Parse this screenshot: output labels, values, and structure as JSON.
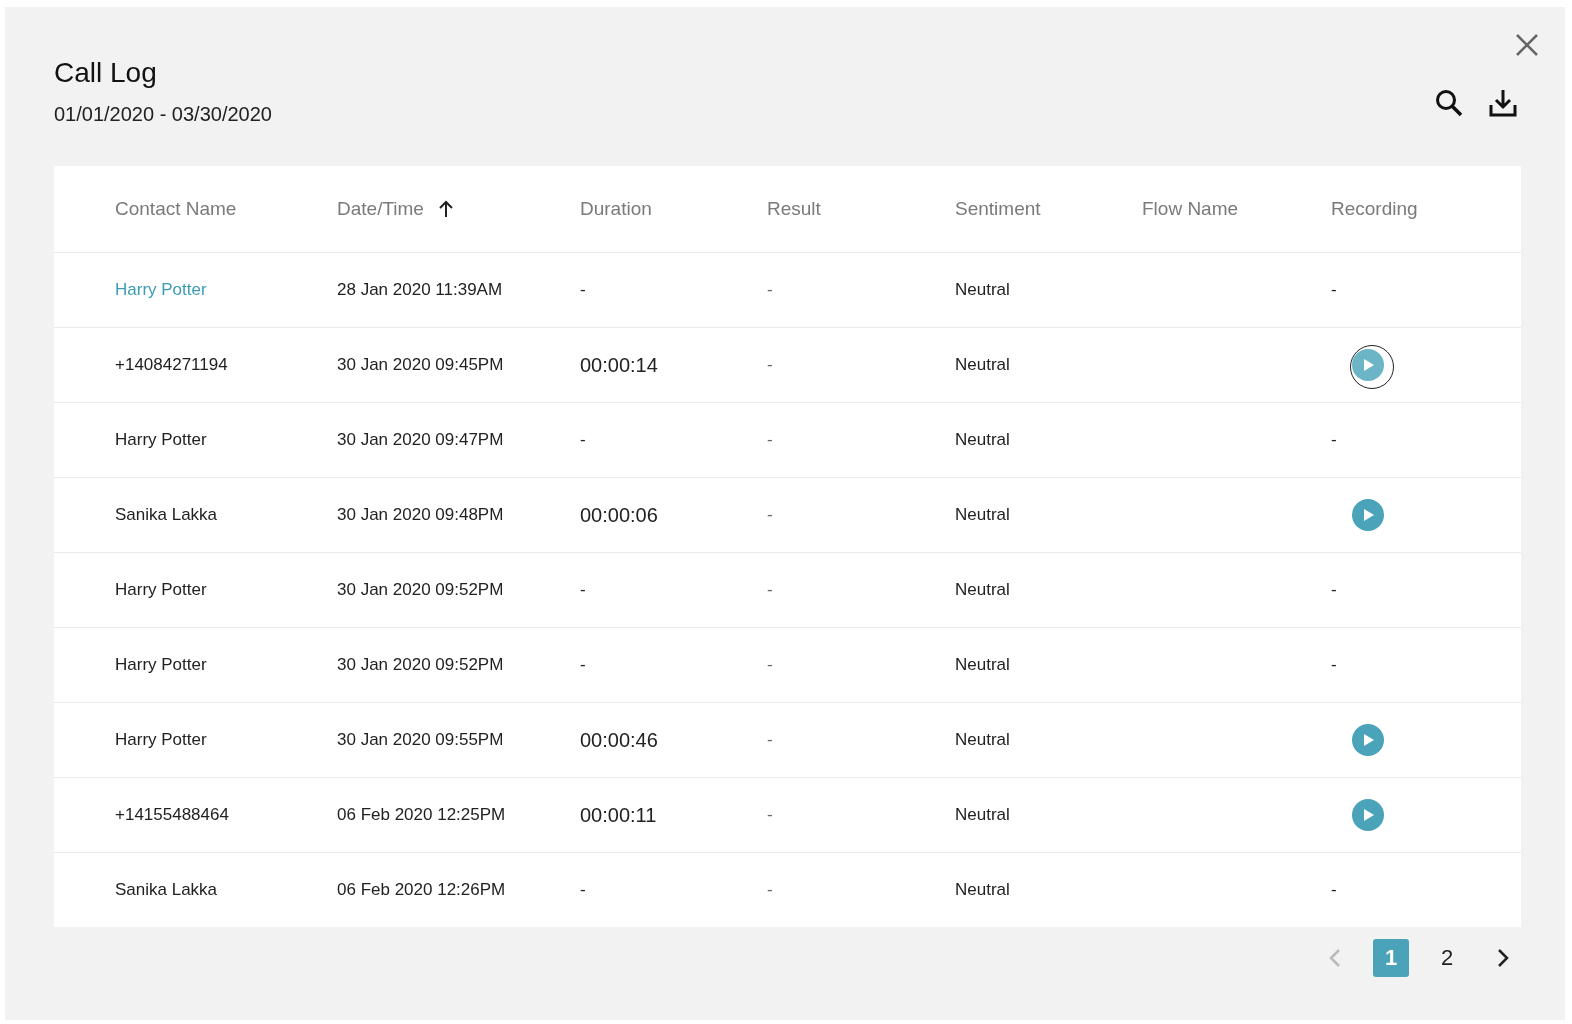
{
  "dialog": {
    "title": "Call Log",
    "date_range": "01/01/2020 - 03/30/2020"
  },
  "table": {
    "columns": [
      {
        "label": "Contact Name",
        "sorted": false
      },
      {
        "label": "Date/Time",
        "sorted": true
      },
      {
        "label": "Duration",
        "sorted": false
      },
      {
        "label": "Result",
        "sorted": false
      },
      {
        "label": "Sentiment",
        "sorted": false
      },
      {
        "label": "Flow Name",
        "sorted": false
      },
      {
        "label": "Recording",
        "sorted": false
      }
    ],
    "rows": [
      {
        "contact": "Harry Potter",
        "link": true,
        "datetime": "28 Jan 2020 11:39AM",
        "duration": "-",
        "result": "-",
        "sentiment": "Neutral",
        "recording": {
          "kind": "none",
          "text": "-"
        }
      },
      {
        "contact": "+14084271194",
        "link": false,
        "datetime": "30 Jan 2020 09:45PM",
        "duration": "00:00:14",
        "result": "-",
        "sentiment": "Neutral",
        "recording": {
          "kind": "play",
          "hovered": true
        }
      },
      {
        "contact": "Harry Potter",
        "link": false,
        "datetime": "30 Jan 2020 09:47PM",
        "duration": "-",
        "result": "-",
        "sentiment": "Neutral",
        "recording": {
          "kind": "none",
          "text": "-"
        }
      },
      {
        "contact": "Sanika Lakka",
        "link": false,
        "datetime": "30 Jan 2020 09:48PM",
        "duration": "00:00:06",
        "result": "-",
        "sentiment": "Neutral",
        "recording": {
          "kind": "play",
          "hovered": false
        }
      },
      {
        "contact": "Harry Potter",
        "link": false,
        "datetime": "30 Jan 2020 09:52PM",
        "duration": "-",
        "result": "-",
        "sentiment": "Neutral",
        "recording": {
          "kind": "none",
          "text": "-"
        }
      },
      {
        "contact": "Harry Potter",
        "link": false,
        "datetime": "30 Jan 2020 09:52PM",
        "duration": "-",
        "result": "-",
        "sentiment": "Neutral",
        "recording": {
          "kind": "none",
          "text": "-"
        }
      },
      {
        "contact": "Harry Potter",
        "link": false,
        "datetime": "30 Jan 2020 09:55PM",
        "duration": "00:00:46",
        "result": "-",
        "sentiment": "Neutral",
        "recording": {
          "kind": "play",
          "hovered": false
        }
      },
      {
        "contact": "+14155488464",
        "link": false,
        "datetime": "06 Feb 2020 12:25PM",
        "duration": "00:00:11",
        "result": "-",
        "sentiment": "Neutral",
        "recording": {
          "kind": "play",
          "hovered": false
        }
      },
      {
        "contact": "Sanika Lakka",
        "link": false,
        "datetime": "06 Feb 2020 12:26PM",
        "duration": "-",
        "result": "-",
        "sentiment": "Neutral",
        "recording": {
          "kind": "none",
          "text": "-"
        }
      }
    ]
  },
  "pagination": {
    "prev_disabled": true,
    "pages": [
      {
        "label": "1",
        "selected": true
      },
      {
        "label": "2",
        "selected": false
      }
    ]
  }
}
